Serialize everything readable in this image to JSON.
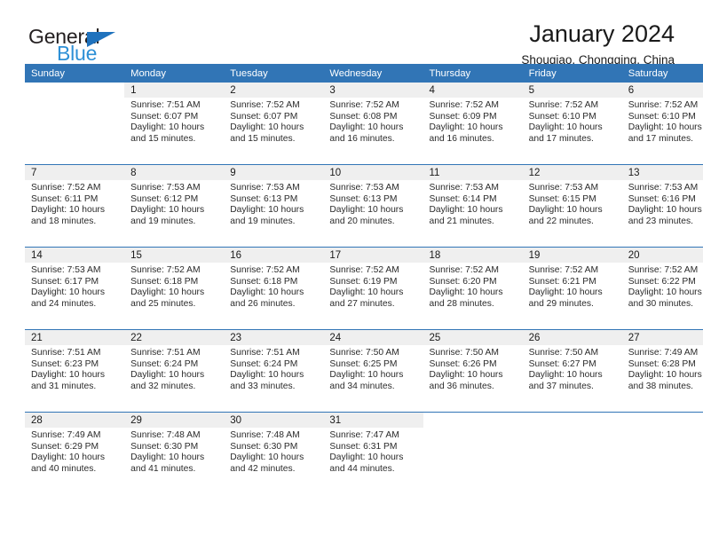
{
  "brand": {
    "name_part1": "General",
    "name_part2": "Blue",
    "triangle_icon": "triangle-icon",
    "color_dark": "#231f20",
    "color_blue": "#2e90d6",
    "color_triangle": "#1f72bd"
  },
  "header": {
    "title": "January 2024",
    "subtitle": "Shouqiao, Chongqing, China"
  },
  "colors": {
    "header_blue": "#3175b6",
    "daynum_band": "#efefef",
    "text": "#1a1a1a"
  },
  "weekdays": [
    "Sunday",
    "Monday",
    "Tuesday",
    "Wednesday",
    "Thursday",
    "Friday",
    "Saturday"
  ],
  "weeks": [
    [
      {
        "day": "",
        "lines": []
      },
      {
        "day": "1",
        "lines": [
          "Sunrise: 7:51 AM",
          "Sunset: 6:07 PM",
          "Daylight: 10 hours",
          "and 15 minutes."
        ]
      },
      {
        "day": "2",
        "lines": [
          "Sunrise: 7:52 AM",
          "Sunset: 6:07 PM",
          "Daylight: 10 hours",
          "and 15 minutes."
        ]
      },
      {
        "day": "3",
        "lines": [
          "Sunrise: 7:52 AM",
          "Sunset: 6:08 PM",
          "Daylight: 10 hours",
          "and 16 minutes."
        ]
      },
      {
        "day": "4",
        "lines": [
          "Sunrise: 7:52 AM",
          "Sunset: 6:09 PM",
          "Daylight: 10 hours",
          "and 16 minutes."
        ]
      },
      {
        "day": "5",
        "lines": [
          "Sunrise: 7:52 AM",
          "Sunset: 6:10 PM",
          "Daylight: 10 hours",
          "and 17 minutes."
        ]
      },
      {
        "day": "6",
        "lines": [
          "Sunrise: 7:52 AM",
          "Sunset: 6:10 PM",
          "Daylight: 10 hours",
          "and 17 minutes."
        ]
      }
    ],
    [
      {
        "day": "7",
        "lines": [
          "Sunrise: 7:52 AM",
          "Sunset: 6:11 PM",
          "Daylight: 10 hours",
          "and 18 minutes."
        ]
      },
      {
        "day": "8",
        "lines": [
          "Sunrise: 7:53 AM",
          "Sunset: 6:12 PM",
          "Daylight: 10 hours",
          "and 19 minutes."
        ]
      },
      {
        "day": "9",
        "lines": [
          "Sunrise: 7:53 AM",
          "Sunset: 6:13 PM",
          "Daylight: 10 hours",
          "and 19 minutes."
        ]
      },
      {
        "day": "10",
        "lines": [
          "Sunrise: 7:53 AM",
          "Sunset: 6:13 PM",
          "Daylight: 10 hours",
          "and 20 minutes."
        ]
      },
      {
        "day": "11",
        "lines": [
          "Sunrise: 7:53 AM",
          "Sunset: 6:14 PM",
          "Daylight: 10 hours",
          "and 21 minutes."
        ]
      },
      {
        "day": "12",
        "lines": [
          "Sunrise: 7:53 AM",
          "Sunset: 6:15 PM",
          "Daylight: 10 hours",
          "and 22 minutes."
        ]
      },
      {
        "day": "13",
        "lines": [
          "Sunrise: 7:53 AM",
          "Sunset: 6:16 PM",
          "Daylight: 10 hours",
          "and 23 minutes."
        ]
      }
    ],
    [
      {
        "day": "14",
        "lines": [
          "Sunrise: 7:53 AM",
          "Sunset: 6:17 PM",
          "Daylight: 10 hours",
          "and 24 minutes."
        ]
      },
      {
        "day": "15",
        "lines": [
          "Sunrise: 7:52 AM",
          "Sunset: 6:18 PM",
          "Daylight: 10 hours",
          "and 25 minutes."
        ]
      },
      {
        "day": "16",
        "lines": [
          "Sunrise: 7:52 AM",
          "Sunset: 6:18 PM",
          "Daylight: 10 hours",
          "and 26 minutes."
        ]
      },
      {
        "day": "17",
        "lines": [
          "Sunrise: 7:52 AM",
          "Sunset: 6:19 PM",
          "Daylight: 10 hours",
          "and 27 minutes."
        ]
      },
      {
        "day": "18",
        "lines": [
          "Sunrise: 7:52 AM",
          "Sunset: 6:20 PM",
          "Daylight: 10 hours",
          "and 28 minutes."
        ]
      },
      {
        "day": "19",
        "lines": [
          "Sunrise: 7:52 AM",
          "Sunset: 6:21 PM",
          "Daylight: 10 hours",
          "and 29 minutes."
        ]
      },
      {
        "day": "20",
        "lines": [
          "Sunrise: 7:52 AM",
          "Sunset: 6:22 PM",
          "Daylight: 10 hours",
          "and 30 minutes."
        ]
      }
    ],
    [
      {
        "day": "21",
        "lines": [
          "Sunrise: 7:51 AM",
          "Sunset: 6:23 PM",
          "Daylight: 10 hours",
          "and 31 minutes."
        ]
      },
      {
        "day": "22",
        "lines": [
          "Sunrise: 7:51 AM",
          "Sunset: 6:24 PM",
          "Daylight: 10 hours",
          "and 32 minutes."
        ]
      },
      {
        "day": "23",
        "lines": [
          "Sunrise: 7:51 AM",
          "Sunset: 6:24 PM",
          "Daylight: 10 hours",
          "and 33 minutes."
        ]
      },
      {
        "day": "24",
        "lines": [
          "Sunrise: 7:50 AM",
          "Sunset: 6:25 PM",
          "Daylight: 10 hours",
          "and 34 minutes."
        ]
      },
      {
        "day": "25",
        "lines": [
          "Sunrise: 7:50 AM",
          "Sunset: 6:26 PM",
          "Daylight: 10 hours",
          "and 36 minutes."
        ]
      },
      {
        "day": "26",
        "lines": [
          "Sunrise: 7:50 AM",
          "Sunset: 6:27 PM",
          "Daylight: 10 hours",
          "and 37 minutes."
        ]
      },
      {
        "day": "27",
        "lines": [
          "Sunrise: 7:49 AM",
          "Sunset: 6:28 PM",
          "Daylight: 10 hours",
          "and 38 minutes."
        ]
      }
    ],
    [
      {
        "day": "28",
        "lines": [
          "Sunrise: 7:49 AM",
          "Sunset: 6:29 PM",
          "Daylight: 10 hours",
          "and 40 minutes."
        ]
      },
      {
        "day": "29",
        "lines": [
          "Sunrise: 7:48 AM",
          "Sunset: 6:30 PM",
          "Daylight: 10 hours",
          "and 41 minutes."
        ]
      },
      {
        "day": "30",
        "lines": [
          "Sunrise: 7:48 AM",
          "Sunset: 6:30 PM",
          "Daylight: 10 hours",
          "and 42 minutes."
        ]
      },
      {
        "day": "31",
        "lines": [
          "Sunrise: 7:47 AM",
          "Sunset: 6:31 PM",
          "Daylight: 10 hours",
          "and 44 minutes."
        ]
      },
      {
        "day": "",
        "lines": []
      },
      {
        "day": "",
        "lines": []
      },
      {
        "day": "",
        "lines": []
      }
    ]
  ]
}
